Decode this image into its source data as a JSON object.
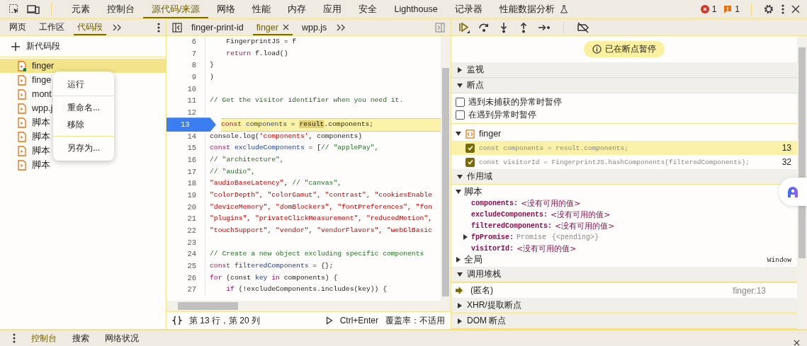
{
  "toolbar": {
    "tabs": [
      {
        "label": "元素",
        "selected": false
      },
      {
        "label": "控制台",
        "selected": false
      },
      {
        "label": "源代码/来源",
        "selected": true
      },
      {
        "label": "网络",
        "selected": false
      },
      {
        "label": "性能",
        "selected": false
      },
      {
        "label": "内存",
        "selected": false
      },
      {
        "label": "应用",
        "selected": false
      },
      {
        "label": "安全",
        "selected": false
      },
      {
        "label": "Lighthouse",
        "selected": false
      },
      {
        "label": "记录器",
        "selected": false
      },
      {
        "label": "性能数据分析",
        "selected": false,
        "experimental": true
      }
    ],
    "errors": "1",
    "warnings": "1"
  },
  "left_panel": {
    "tabs": [
      {
        "label": "网页",
        "selected": false
      },
      {
        "label": "工作区",
        "selected": false
      },
      {
        "label": "代码段",
        "selected": true
      }
    ],
    "new_snippet": "新代码段",
    "snippets": [
      {
        "name": "finger",
        "selected": true,
        "running": true
      },
      {
        "name": "finge",
        "selected": false,
        "running": false
      },
      {
        "name": "mont",
        "selected": false,
        "running": false
      },
      {
        "name": "wpp.j",
        "selected": false,
        "running": false
      },
      {
        "name": "脚本",
        "selected": false,
        "running": false
      },
      {
        "name": "脚本",
        "selected": false,
        "running": false
      },
      {
        "name": "脚本",
        "selected": false,
        "running": false
      },
      {
        "name": "脚本",
        "selected": false,
        "running": false
      }
    ]
  },
  "context_menu": {
    "groups": [
      [
        "运行"
      ],
      [
        "重命名...",
        "移除"
      ],
      [
        "另存为..."
      ]
    ]
  },
  "editor": {
    "tabs": [
      {
        "label": "finger-print-id",
        "selected": false
      },
      {
        "label": "finger",
        "selected": true
      },
      {
        "label": "wpp.js",
        "selected": false
      }
    ],
    "lines": [
      {
        "number": "6",
        "current": false,
        "indent": true,
        "tokens": [
          {
            "kind": "plain",
            "text": "FingerprintJS = f"
          }
        ]
      },
      {
        "number": "7",
        "current": false,
        "indent": true,
        "tokens": [
          {
            "kind": "kw",
            "text": "return"
          },
          {
            "kind": "plain",
            "text": " f.load()"
          }
        ]
      },
      {
        "number": "8",
        "current": false,
        "indent": false,
        "tokens": [
          {
            "kind": "plain",
            "text": "}"
          }
        ]
      },
      {
        "number": "9",
        "current": false,
        "indent": false,
        "tokens": [
          {
            "kind": "plain",
            "text": ")"
          }
        ]
      },
      {
        "number": "10",
        "current": false
      },
      {
        "number": "11",
        "current": false,
        "indent": false,
        "tokens": [
          {
            "kind": "cmt",
            "text": "// Get the visitor identifier when you need it."
          }
        ]
      },
      {
        "number": "12",
        "current": false
      },
      {
        "number": "13",
        "current": true,
        "indent": false,
        "tokens": [
          {
            "kind": "kw",
            "text": "const"
          },
          {
            "kind": "var",
            "text": " components"
          },
          {
            "kind": "plain",
            "text": " = "
          },
          {
            "kind": "hl",
            "text": "result"
          },
          {
            "kind": "plain",
            "text": ".components;"
          }
        ]
      },
      {
        "number": "14",
        "current": false,
        "indent": false,
        "tokens": [
          {
            "kind": "plain",
            "text": "console.log("
          },
          {
            "kind": "str",
            "text": "'components'"
          },
          {
            "kind": "plain",
            "text": ", components)"
          }
        ]
      },
      {
        "number": "15",
        "current": false,
        "indent": false,
        "tokens": [
          {
            "kind": "kw",
            "text": "const"
          },
          {
            "kind": "var",
            "text": " excludeComponents"
          },
          {
            "kind": "plain",
            "text": " = ["
          },
          {
            "kind": "cmt",
            "text": "// \"applePay\","
          }
        ]
      },
      {
        "number": "16",
        "current": false,
        "indent": false,
        "tokens": [
          {
            "kind": "cmt",
            "text": "// \"architecture\","
          }
        ]
      },
      {
        "number": "17",
        "current": false,
        "indent": false,
        "tokens": [
          {
            "kind": "cmt",
            "text": "// \"audio\","
          }
        ]
      },
      {
        "number": "18",
        "current": false,
        "indent": false,
        "tokens": [
          {
            "kind": "str",
            "text": "\"audioBaseLatency\""
          },
          {
            "kind": "plain",
            "text": ", "
          },
          {
            "kind": "cmt",
            "text": "// \"canvas\","
          }
        ]
      },
      {
        "number": "19",
        "current": false,
        "indent": false,
        "tokens": [
          {
            "kind": "str",
            "text": "\"colorDepth\", \"colorGamut\", \"contrast\", \"cookiesEnable"
          }
        ]
      },
      {
        "number": "20",
        "current": false,
        "indent": false,
        "tokens": [
          {
            "kind": "str",
            "text": "\"deviceMemory\", \"domBlockers\", \"fontPreferences\", \"fon"
          }
        ]
      },
      {
        "number": "21",
        "current": false,
        "indent": false,
        "tokens": [
          {
            "kind": "str",
            "text": "\"plugins\", \"privateClickMeasurement\", \"reducedMotion\","
          }
        ]
      },
      {
        "number": "22",
        "current": false,
        "indent": false,
        "tokens": [
          {
            "kind": "str",
            "text": "\"touchSupport\", \"vendor\", \"vendorFlavors\", \"webGlBasic"
          }
        ]
      },
      {
        "number": "23",
        "current": false
      },
      {
        "number": "24",
        "current": false,
        "indent": false,
        "tokens": [
          {
            "kind": "cmt",
            "text": "// Create a new object excluding specific components"
          }
        ]
      },
      {
        "number": "25",
        "current": false,
        "indent": false,
        "tokens": [
          {
            "kind": "kw",
            "text": "const"
          },
          {
            "kind": "var",
            "text": " filteredComponents"
          },
          {
            "kind": "plain",
            "text": " = {};"
          }
        ]
      },
      {
        "number": "26",
        "current": false,
        "indent": false,
        "tokens": [
          {
            "kind": "kw",
            "text": "for"
          },
          {
            "kind": "plain",
            "text": " (const"
          },
          {
            "kind": "var",
            "text": " key"
          },
          {
            "kind": "kw",
            "text": " in"
          },
          {
            "kind": "plain",
            "text": " components) {"
          }
        ]
      },
      {
        "number": "27",
        "current": false,
        "indent": true,
        "tokens": [
          {
            "kind": "kw",
            "text": "if"
          },
          {
            "kind": "plain",
            "text": " (!excludeComponents.includes(key)) {"
          }
        ]
      }
    ],
    "status": {
      "position": "第 13 行，第 20 列",
      "shortcut": "Ctrl+Enter",
      "coverage": "覆盖率：不适用"
    }
  },
  "debugger": {
    "paused": "已在断点暂停",
    "watch": {
      "title": "监视",
      "expanded": false
    },
    "breakpoints": {
      "title": "断点",
      "expanded": true,
      "options": [
        {
          "label": "遇到未捕获的异常时暂停",
          "checked": false
        },
        {
          "label": "在遇到异常时暂停",
          "checked": false
        }
      ],
      "files": [
        {
          "name": "finger",
          "expanded": true,
          "items": [
            {
              "code": "const components = result.components;",
              "line": "13",
              "checked": true,
              "selected": true
            },
            {
              "code": "const visitorId = FingerprintJS.hashComponents(filteredComponents);",
              "line": "32",
              "checked": true,
              "selected": false
            }
          ]
        }
      ]
    },
    "scope": {
      "title": "作用域",
      "expanded": true,
      "groups": [
        {
          "name": "脚本",
          "expanded": true,
          "vars": [
            {
              "name": "components:",
              "kind": "unavailable",
              "value": "<没有可用的值>"
            },
            {
              "name": "excludeComponents:",
              "kind": "unavailable",
              "value": "<没有可用的值>"
            },
            {
              "name": "filteredComponents:",
              "kind": "unavailable",
              "value": "<没有可用的值>"
            },
            {
              "name": "fpPromise:",
              "kind": "object",
              "type": "Promise",
              "value": "{<pending>}"
            },
            {
              "name": "visitorId:",
              "kind": "unavailable",
              "value": "<没有可用的值>"
            }
          ]
        },
        {
          "name": "全局",
          "expanded": false,
          "value": "Window"
        }
      ]
    },
    "call_stack": {
      "title": "调用堆栈",
      "expanded": true,
      "frames": [
        {
          "name": "(匿名)",
          "location": "finger:13",
          "current": true
        }
      ]
    },
    "xhr": {
      "title": "XHR/提取断点",
      "expanded": false
    },
    "dom": {
      "title": "DOM 断点",
      "expanded": false
    }
  },
  "drawer": {
    "tabs": [
      {
        "label": "控制台",
        "selected": true
      },
      {
        "label": "搜索",
        "selected": false
      },
      {
        "label": "网络状况",
        "selected": false
      }
    ]
  }
}
